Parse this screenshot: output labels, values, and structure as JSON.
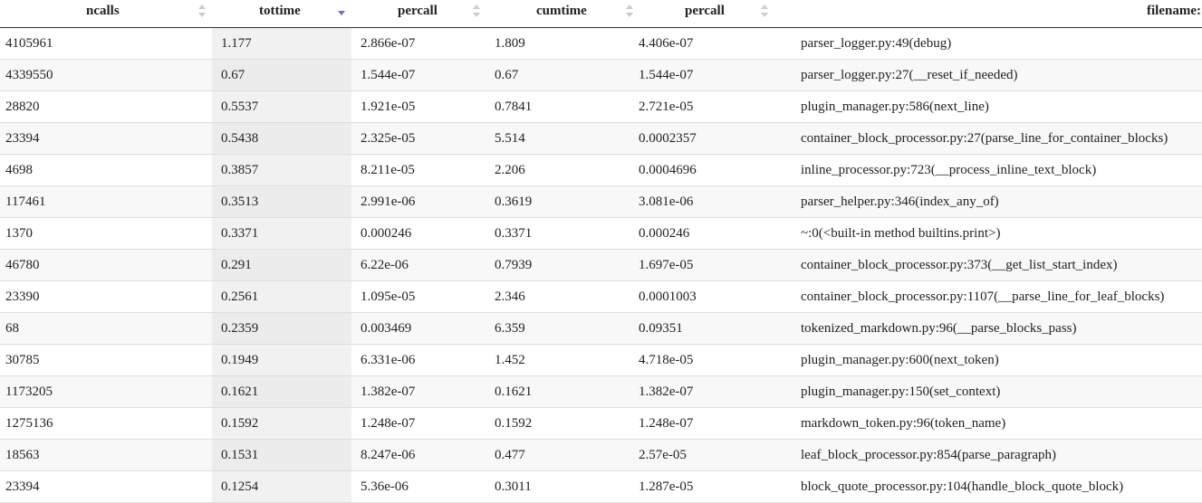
{
  "columns": [
    {
      "label": "ncalls",
      "sort": "none"
    },
    {
      "label": "tottime",
      "sort": "desc"
    },
    {
      "label": "percall",
      "sort": "none"
    },
    {
      "label": "cumtime",
      "sort": "none"
    },
    {
      "label": "percall",
      "sort": "none"
    },
    {
      "label": "filename:",
      "sort": "none"
    }
  ],
  "colors": {
    "sort_active": "#6b6fc8",
    "sort_inactive": "#cccccc",
    "header_rule": "#333333",
    "row_rule": "#dedede"
  },
  "rows": [
    [
      "4105961",
      "1.177",
      "2.866e-07",
      "1.809",
      "4.406e-07",
      "parser_logger.py:49(debug)"
    ],
    [
      "4339550",
      "0.67",
      "1.544e-07",
      "0.67",
      "1.544e-07",
      "parser_logger.py:27(__reset_if_needed)"
    ],
    [
      "28820",
      "0.5537",
      "1.921e-05",
      "0.7841",
      "2.721e-05",
      "plugin_manager.py:586(next_line)"
    ],
    [
      "23394",
      "0.5438",
      "2.325e-05",
      "5.514",
      "0.0002357",
      "container_block_processor.py:27(parse_line_for_container_blocks)"
    ],
    [
      "4698",
      "0.3857",
      "8.211e-05",
      "2.206",
      "0.0004696",
      "inline_processor.py:723(__process_inline_text_block)"
    ],
    [
      "117461",
      "0.3513",
      "2.991e-06",
      "0.3619",
      "3.081e-06",
      "parser_helper.py:346(index_any_of)"
    ],
    [
      "1370",
      "0.3371",
      "0.000246",
      "0.3371",
      "0.000246",
      "~:0(<built-in method builtins.print>)"
    ],
    [
      "46780",
      "0.291",
      "6.22e-06",
      "0.7939",
      "1.697e-05",
      "container_block_processor.py:373(__get_list_start_index)"
    ],
    [
      "23390",
      "0.2561",
      "1.095e-05",
      "2.346",
      "0.0001003",
      "container_block_processor.py:1107(__parse_line_for_leaf_blocks)"
    ],
    [
      "68",
      "0.2359",
      "0.003469",
      "6.359",
      "0.09351",
      "tokenized_markdown.py:96(__parse_blocks_pass)"
    ],
    [
      "30785",
      "0.1949",
      "6.331e-06",
      "1.452",
      "4.718e-05",
      "plugin_manager.py:600(next_token)"
    ],
    [
      "1173205",
      "0.1621",
      "1.382e-07",
      "0.1621",
      "1.382e-07",
      "plugin_manager.py:150(set_context)"
    ],
    [
      "1275136",
      "0.1592",
      "1.248e-07",
      "0.1592",
      "1.248e-07",
      "markdown_token.py:96(token_name)"
    ],
    [
      "18563",
      "0.1531",
      "8.247e-06",
      "0.477",
      "2.57e-05",
      "leaf_block_processor.py:854(parse_paragraph)"
    ],
    [
      "23394",
      "0.1254",
      "5.36e-06",
      "0.3011",
      "1.287e-05",
      "block_quote_processor.py:104(handle_block_quote_block)"
    ]
  ]
}
